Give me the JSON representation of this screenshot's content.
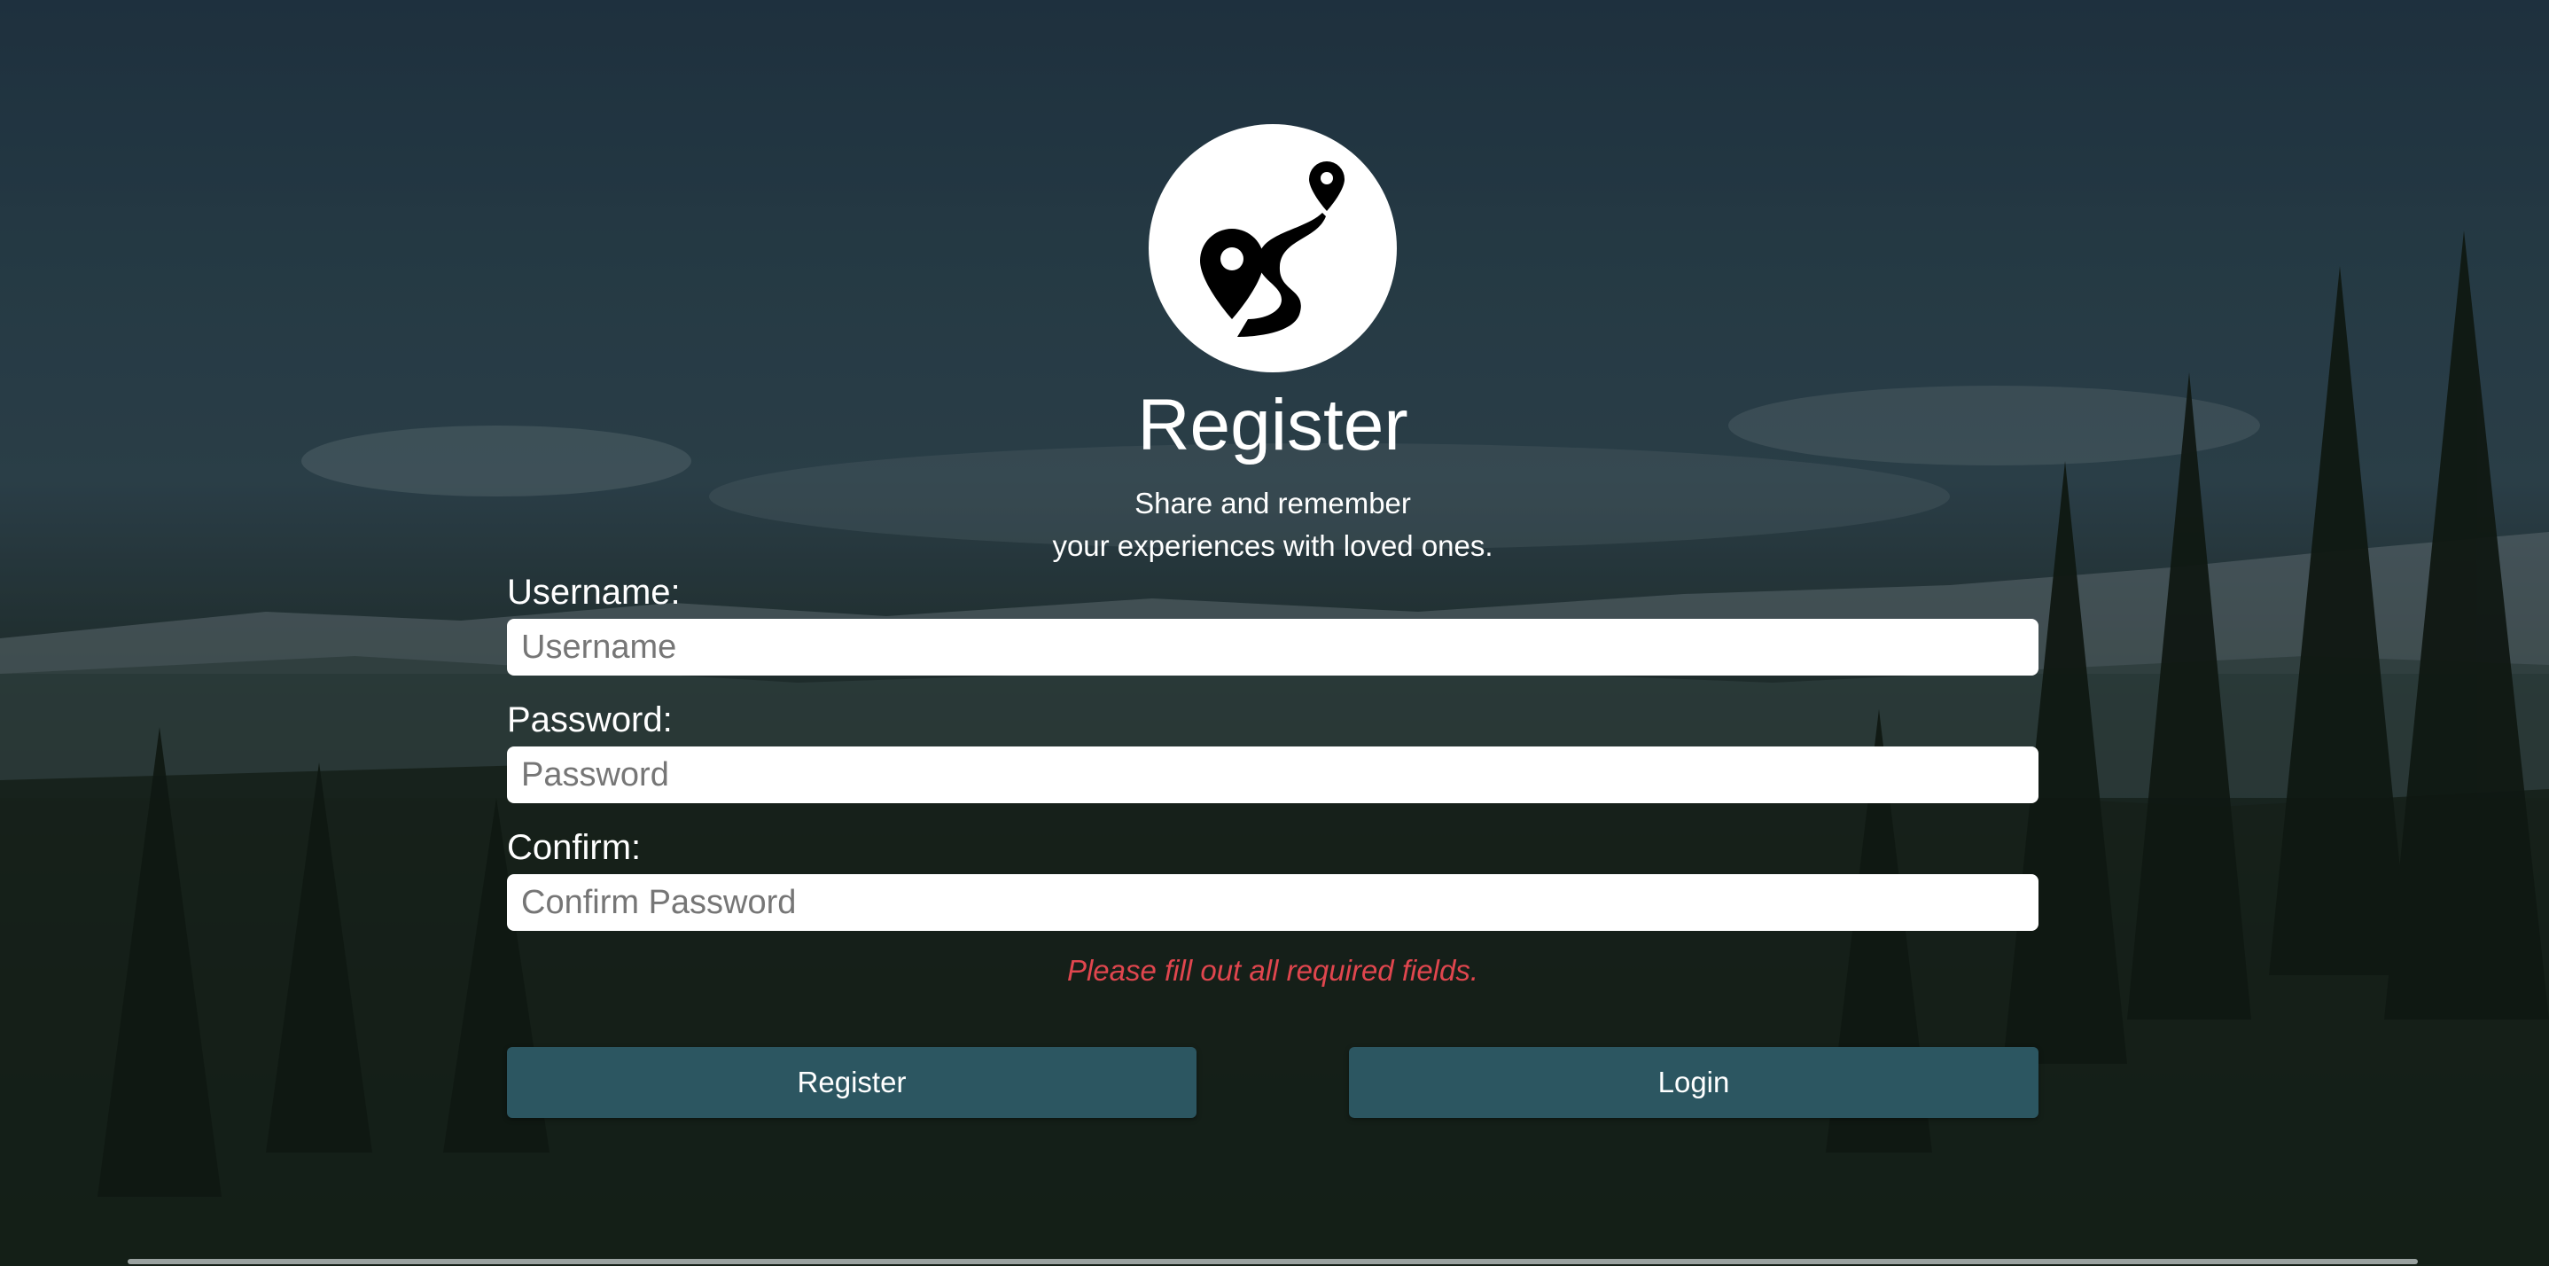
{
  "colors": {
    "button_bg": "#2c5661",
    "error_text": "#e0464e",
    "text_on_bg": "#ffffff"
  },
  "logo": {
    "icon": "map-route-pins-icon"
  },
  "title": "Register",
  "subtitle": {
    "line1": "Share and remember",
    "line2": "your experiences with loved ones."
  },
  "form": {
    "username": {
      "label": "Username:",
      "placeholder": "Username",
      "value": ""
    },
    "password": {
      "label": "Password:",
      "placeholder": "Password",
      "value": ""
    },
    "confirm": {
      "label": "Confirm:",
      "placeholder": "Confirm Password",
      "value": ""
    },
    "error_message": "Please fill out all required fields."
  },
  "buttons": {
    "register_label": "Register",
    "login_label": "Login"
  }
}
